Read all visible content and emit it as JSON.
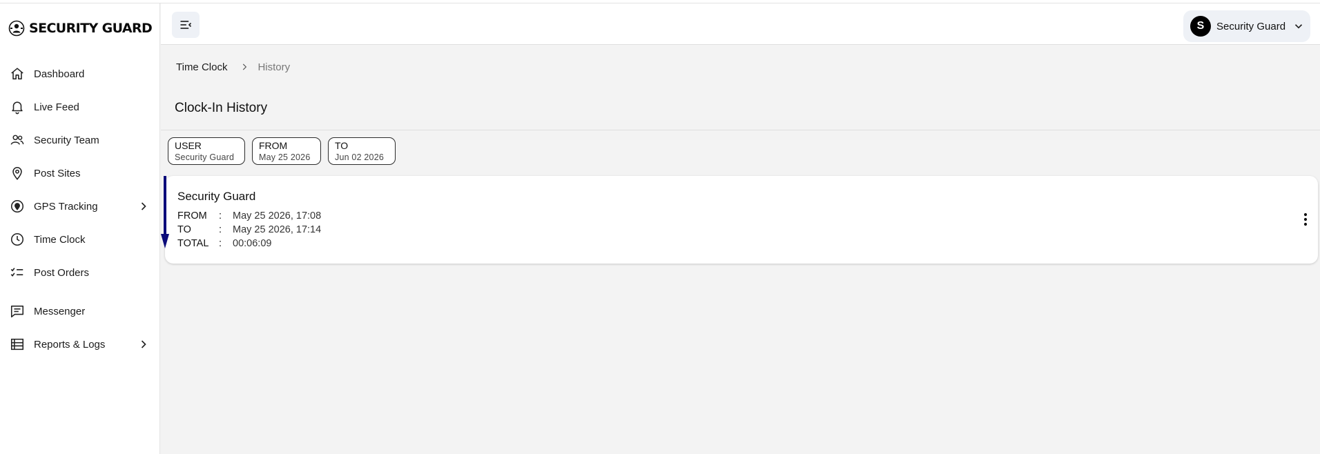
{
  "brand": {
    "logo_text": "SECURITY GUARD"
  },
  "sidebar": {
    "items": [
      {
        "label": "Dashboard",
        "icon": "home-icon"
      },
      {
        "label": "Live Feed",
        "icon": "bell-icon"
      },
      {
        "label": "Security Team",
        "icon": "users-icon"
      },
      {
        "label": "Post Sites",
        "icon": "map-pin-icon"
      },
      {
        "label": "GPS Tracking",
        "icon": "gps-icon",
        "has_submenu": true
      },
      {
        "label": "Time Clock",
        "icon": "clock-icon"
      },
      {
        "label": "Post Orders",
        "icon": "checklist-icon"
      },
      {
        "label": "Messenger",
        "icon": "chat-icon"
      },
      {
        "label": "Reports & Logs",
        "icon": "list-icon",
        "has_submenu": true
      }
    ]
  },
  "header": {
    "menu_icon": "menu-collapse-icon",
    "user": {
      "avatar_initial": "S",
      "name": "Security Guard"
    }
  },
  "breadcrumb": {
    "parent": "Time Clock",
    "current": "History"
  },
  "page": {
    "title": "Clock-In History"
  },
  "filters": [
    {
      "title": "USER",
      "value": "Security Guard"
    },
    {
      "title": "FROM",
      "value": "May 25 2026"
    },
    {
      "title": "TO",
      "value": "Jun 02 2026"
    }
  ],
  "records": [
    {
      "name": "Security Guard",
      "rows": [
        {
          "key": "FROM",
          "sep": ":",
          "value": "May 25 2026, 17:08"
        },
        {
          "key": "TO",
          "sep": ":",
          "value": "May 25 2026, 17:14"
        },
        {
          "key": "TOTAL",
          "sep": ":",
          "value": "00:06:09"
        }
      ]
    }
  ],
  "colors": {
    "background": "#f3f3f3",
    "surface": "#ffffff",
    "chip_bg": "#eef1f6",
    "scroll_arrow": "#0b0b7a"
  }
}
